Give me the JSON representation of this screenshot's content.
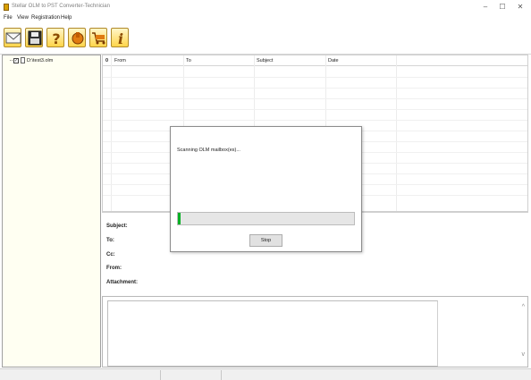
{
  "window": {
    "title": "Stellar OLM to PST Converter-Technician",
    "minimize_glyph": "–",
    "maximize_glyph": "☐",
    "close_glyph": "✕"
  },
  "menu": [
    {
      "label": "File"
    },
    {
      "label": "View"
    },
    {
      "label": "Registration"
    },
    {
      "label": "Help"
    }
  ],
  "toolbar": {
    "buttons": [
      {
        "icon": "select-mailbox-icon"
      },
      {
        "icon": "save-icon"
      },
      {
        "icon": "help-icon"
      },
      {
        "icon": "support-icon"
      },
      {
        "icon": "buy-cart-icon"
      },
      {
        "icon": "info-icon"
      }
    ],
    "accent_color": "#ffd54a"
  },
  "tree": {
    "item_label": "D:\\test3.olm",
    "checked": true
  },
  "grid": {
    "columns": [
      {
        "label": "From"
      },
      {
        "label": "To"
      },
      {
        "label": "Subject"
      },
      {
        "label": "Date"
      }
    ],
    "attachment_glyph": "0"
  },
  "details": {
    "labels": {
      "subject": "Subject:",
      "to": "To:",
      "cc": "Cc:",
      "from": "From:",
      "attachment": "Attachment:"
    }
  },
  "dialog": {
    "message": "Scanning OLM mailbox(es)...",
    "progress_fraction": 0.01,
    "progress_color": "#06b025",
    "stop_label": "Stop"
  },
  "scroll": {
    "up_glyph": "^",
    "down_glyph": "v"
  }
}
